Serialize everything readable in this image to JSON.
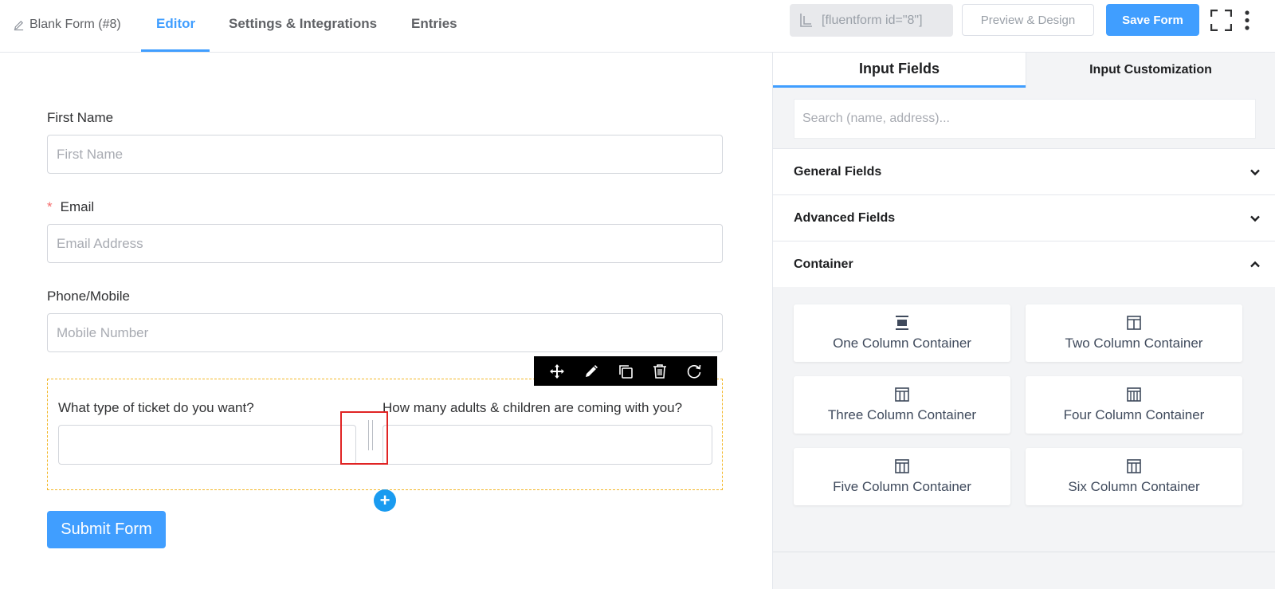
{
  "header": {
    "form_name": "Blank Form (#8)",
    "tabs": [
      {
        "label": "Editor",
        "active": true
      },
      {
        "label": "Settings & Integrations",
        "active": false
      },
      {
        "label": "Entries",
        "active": false
      }
    ],
    "shortcode": "[fluentform id=\"8\"]",
    "preview_label": "Preview & Design",
    "save_label": "Save Form"
  },
  "form": {
    "fields": [
      {
        "label": "First Name",
        "required": false,
        "placeholder": "First Name"
      },
      {
        "label": "Email",
        "required": true,
        "required_mark": "*",
        "placeholder": "Email Address"
      },
      {
        "label": "Phone/Mobile",
        "required": false,
        "placeholder": "Mobile Number"
      }
    ],
    "container": {
      "col1_label": "What type of ticket do you want?",
      "col2_label": "How many adults & children are coming with you?"
    },
    "toolbar_icons": [
      "move-icon",
      "edit-icon",
      "duplicate-icon",
      "delete-icon",
      "refresh-icon"
    ],
    "add_button": "+",
    "submit_label": "Submit Form"
  },
  "sidebar": {
    "tabs": [
      "Input Fields",
      "Input Customization"
    ],
    "search_placeholder": "Search (name, address)...",
    "sections": [
      {
        "label": "General Fields",
        "expanded": false
      },
      {
        "label": "Advanced Fields",
        "expanded": false
      },
      {
        "label": "Container",
        "expanded": true
      }
    ],
    "containers": [
      "One Column Container",
      "Two Column Container",
      "Three Column Container",
      "Four Column Container",
      "Five Column Container",
      "Six Column Container"
    ]
  },
  "colors": {
    "accent": "#409eff",
    "required": "#f56c6c",
    "container_border": "#f3b728",
    "highlight": "#e02424"
  }
}
